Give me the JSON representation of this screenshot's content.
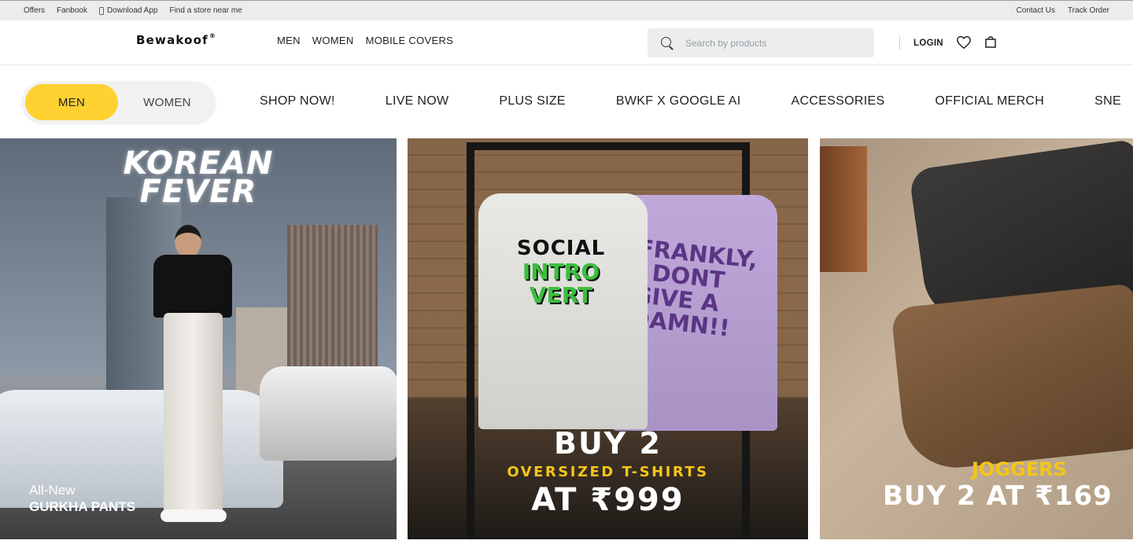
{
  "topbar": {
    "left_links": [
      "Offers",
      "Fanbook",
      "Download App",
      "Find a store near me"
    ],
    "right_links": [
      "Contact Us",
      "Track Order"
    ]
  },
  "header": {
    "logo": "Bewakoof",
    "logo_mark": "®",
    "nav": [
      "MEN",
      "WOMEN",
      "MOBILE COVERS"
    ],
    "search_placeholder": "Search by products",
    "login_label": "LOGIN",
    "icons": [
      "search-icon",
      "heart-icon",
      "bag-icon"
    ]
  },
  "category_bar": {
    "gender_options": [
      "MEN",
      "WOMEN"
    ],
    "selected_gender": "MEN",
    "accent_color": "#ffd232",
    "categories": [
      "SHOP NOW!",
      "LIVE NOW",
      "PLUS SIZE",
      "BWKF X GOOGLE AI",
      "ACCESSORIES",
      "OFFICIAL MERCH",
      "SNE"
    ]
  },
  "banners": [
    {
      "headline_line1": "KOREAN",
      "headline_line2": "FEVER",
      "caption_line1": "All-New",
      "caption_line2": "GURKHA PANTS"
    },
    {
      "tee1_top": "SOCIAL",
      "tee1_art_line1": "INTRO",
      "tee1_art_line2": "VERT",
      "tee2_art": "FRANKLY, I DONT GIVE A DAMN!!",
      "offer_line1": "BUY 2",
      "offer_line2": "OVERSIZED T-SHIRTS",
      "offer_line3": "AT ₹999",
      "highlight_color": "#f5c518"
    },
    {
      "offer_line1": "JOGGERS",
      "offer_line2": "BUY 2 AT ₹169"
    }
  ]
}
